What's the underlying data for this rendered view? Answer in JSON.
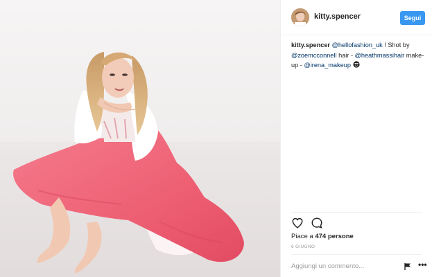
{
  "post": {
    "image_alt": "Woman in pink skirt and white shirt sitting on the floor"
  },
  "header": {
    "username": "kitty.spencer",
    "follow_label": "Segui"
  },
  "caption": {
    "username": "kitty.spencer",
    "parts": [
      {
        "type": "mention",
        "text": "@hellofashion_uk"
      },
      {
        "type": "text",
        "text": " ! Shot by "
      },
      {
        "type": "mention",
        "text": "@zoemcconnell"
      },
      {
        "type": "text",
        "text": " hair - "
      },
      {
        "type": "mention",
        "text": "@heathmassihair"
      },
      {
        "type": "text",
        "text": " make-up - "
      },
      {
        "type": "mention",
        "text": "@irena_makeup"
      },
      {
        "type": "text",
        "text": " "
      }
    ],
    "emoji": "heart-eyes"
  },
  "actions": {
    "like_icon": "heart-icon",
    "comment_icon": "comment-icon"
  },
  "likes": {
    "prefix": "Piace a ",
    "count": "474 persone"
  },
  "date": "6 GIUGNO",
  "comment_box": {
    "placeholder": "Aggiungi un commento..."
  },
  "colors": {
    "accent": "#3897f0",
    "mention": "#003569",
    "skirt": "#f06a7d"
  }
}
